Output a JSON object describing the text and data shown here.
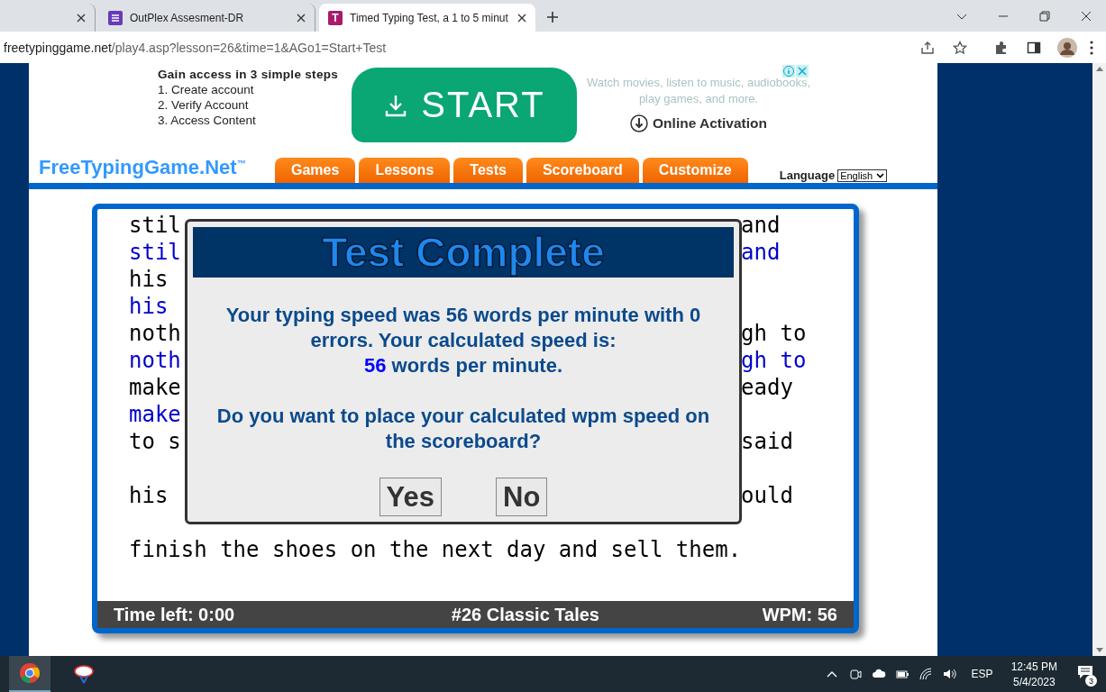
{
  "browser": {
    "tabs": [
      {
        "selected": false
      },
      {
        "title": "OutPlex Assesment-DR",
        "selected": false
      },
      {
        "title": "Timed Typing Test, a 1 to 5 minut",
        "favicon_letter": "T",
        "selected": true
      }
    ],
    "url_host": "freetypinggame.net",
    "url_path": "/play4.asp?lesson=26&time=1&AGo1=Start+Test"
  },
  "ad": {
    "heading": "Gain access in 3 simple steps",
    "steps": [
      "1. Create account",
      "2. Verify Account",
      "3. Access Content"
    ],
    "start_button": "START",
    "blurb": "Watch movies, listen to music, audiobooks, play games, and more.",
    "activation": "Online Activation"
  },
  "site": {
    "logo": "FreeTypingGame.Net",
    "logo_mark": "™",
    "nav": [
      {
        "label": "Games"
      },
      {
        "label": "Lessons"
      },
      {
        "label": "Tests"
      },
      {
        "label": "Scoreboard"
      },
      {
        "label": "Customize"
      }
    ],
    "language_label": "Language",
    "language_value": "English"
  },
  "passage": {
    "lines": [
      {
        "kind": "source",
        "left": "stil",
        "right": "and"
      },
      {
        "kind": "typed",
        "left": "stil",
        "right": "and"
      },
      {
        "kind": "source",
        "left": "his"
      },
      {
        "kind": "typed",
        "left": "his"
      },
      {
        "kind": "source",
        "left": "noth",
        "right": "gh to"
      },
      {
        "kind": "typed",
        "left": "noth",
        "right": "gh to"
      },
      {
        "kind": "source",
        "left": "make",
        "right": "eady"
      },
      {
        "kind": "typed",
        "left": "make"
      },
      {
        "kind": "source",
        "left": "to s",
        "right": "said"
      },
      {
        "kind": "blank"
      },
      {
        "kind": "source",
        "left": "his",
        "right": "ould"
      },
      {
        "kind": "blank"
      },
      {
        "kind": "source",
        "left": "finish the shoes on the next day and sell them."
      }
    ],
    "time_left": "Time left: 0:00",
    "lesson": "#26 Classic Tales",
    "wpm": "WPM: 56"
  },
  "dialog": {
    "title": "Test Complete",
    "message_lead": "Your typing speed was 56 words per minute with 0 errors. Your calculated speed is:",
    "calculated_wpm": "56",
    "calculated_suffix": "words per minute.",
    "question": "Do you want to place your calculated wpm speed on the scoreboard?",
    "buttons": [
      "Yes",
      "No"
    ]
  },
  "taskbar": {
    "language": "ESP",
    "time": "12:45 PM",
    "date": "5/4/2023",
    "notifications": "3"
  }
}
